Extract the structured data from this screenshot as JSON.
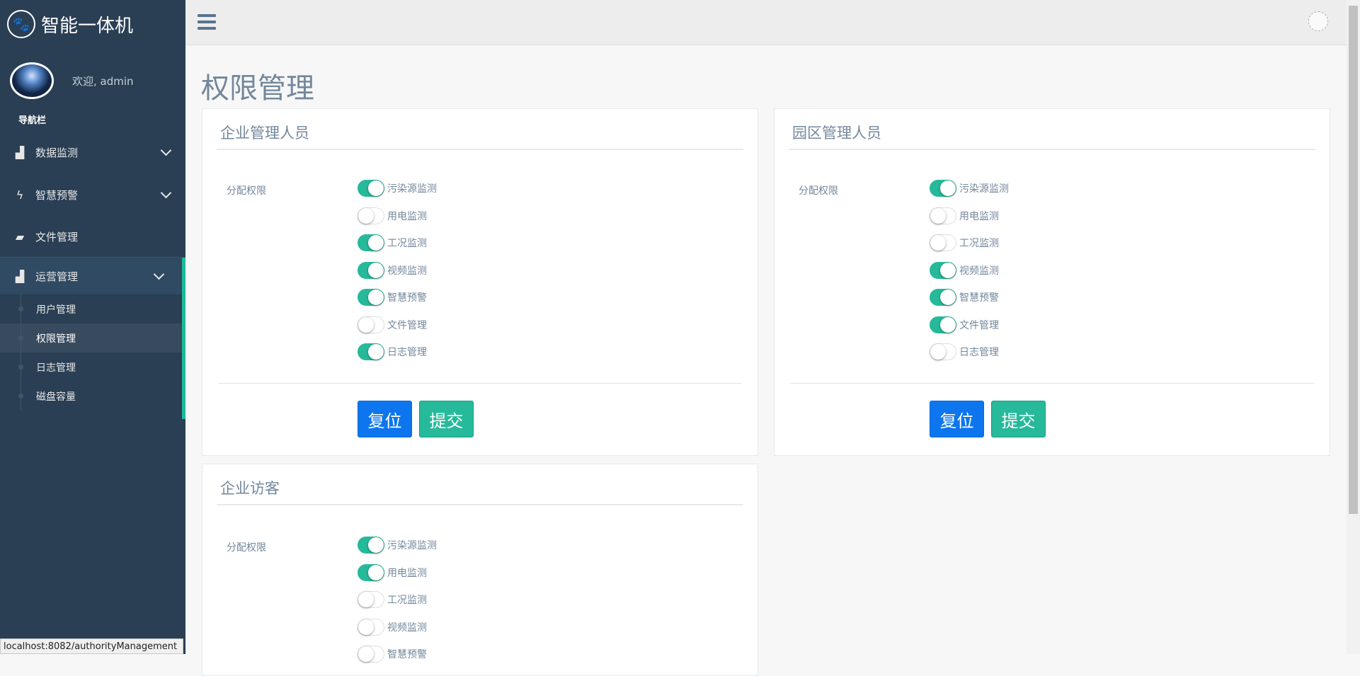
{
  "brand": {
    "title": "智能一体机",
    "icon": "paw-icon"
  },
  "profile": {
    "welcome": "欢迎, admin"
  },
  "nav_heading": "导航栏",
  "menu": [
    {
      "icon": "bar-chart-icon",
      "glyph": "▟",
      "label": "数据监测"
    },
    {
      "icon": "bolt-icon",
      "glyph": "ϟ",
      "label": "智慧预警"
    },
    {
      "icon": "folder-open-icon",
      "glyph": "▰",
      "label": "文件管理"
    }
  ],
  "ops_menu": {
    "icon": "bar-chart-icon",
    "glyph": "▟",
    "label": "运营管理",
    "items": [
      "用户管理",
      "权限管理",
      "日志管理",
      "磁盘容量"
    ],
    "current": "权限管理"
  },
  "page_title": "权限管理",
  "perm_label": "分配权限",
  "buttons": {
    "reset": "复位",
    "submit": "提交"
  },
  "panels": [
    {
      "title": "企业管理人员",
      "perms": [
        {
          "label": "污染源监测",
          "on": true
        },
        {
          "label": "用电监测",
          "on": false
        },
        {
          "label": "工况监测",
          "on": true
        },
        {
          "label": "视频监测",
          "on": true
        },
        {
          "label": "智慧预警",
          "on": true
        },
        {
          "label": "文件管理",
          "on": false
        },
        {
          "label": "日志管理",
          "on": true
        }
      ]
    },
    {
      "title": "园区管理人员",
      "perms": [
        {
          "label": "污染源监测",
          "on": true
        },
        {
          "label": "用电监测",
          "on": false
        },
        {
          "label": "工况监测",
          "on": false
        },
        {
          "label": "视频监测",
          "on": true
        },
        {
          "label": "智慧预警",
          "on": true
        },
        {
          "label": "文件管理",
          "on": true
        },
        {
          "label": "日志管理",
          "on": false
        }
      ]
    },
    {
      "title": "企业访客",
      "perms": [
        {
          "label": "污染源监测",
          "on": true
        },
        {
          "label": "用电监测",
          "on": true
        },
        {
          "label": "工况监测",
          "on": false
        },
        {
          "label": "视频监测",
          "on": false
        },
        {
          "label": "智慧预警",
          "on": false
        }
      ]
    }
  ],
  "status_url": "localhost:8082/authorityManagement",
  "colors": {
    "sidebar": "#2a3f54",
    "accent": "#26b99a",
    "primary": "#0d76ee"
  }
}
